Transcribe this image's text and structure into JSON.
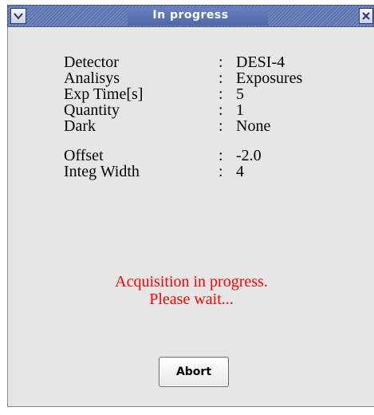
{
  "window": {
    "title": "In progress",
    "menu_icon": "chevron-down-icon",
    "close_icon": "close-icon"
  },
  "info": {
    "rows": [
      {
        "label": "Detector",
        "colon": ":",
        "value": "DESI-4"
      },
      {
        "label": "Analisys",
        "colon": ":",
        "value": "Exposures"
      },
      {
        "label": "Exp Time[s]",
        "colon": ":",
        "value": "5"
      },
      {
        "label": "Quantity",
        "colon": ":",
        "value": "1"
      },
      {
        "label": "Dark",
        "colon": ":",
        "value": "None"
      },
      {
        "label": "Offset",
        "colon": ":",
        "value": "-2.0"
      },
      {
        "label": "Integ Width",
        "colon": ":",
        "value": "4"
      }
    ]
  },
  "message": {
    "line1": "Acquisition in progress.",
    "line2": "Please wait..."
  },
  "abort_label": "Abort",
  "colors": {
    "title_bar": "#5b72b0",
    "body": "#e6e6e6",
    "message": "#ff0000"
  }
}
